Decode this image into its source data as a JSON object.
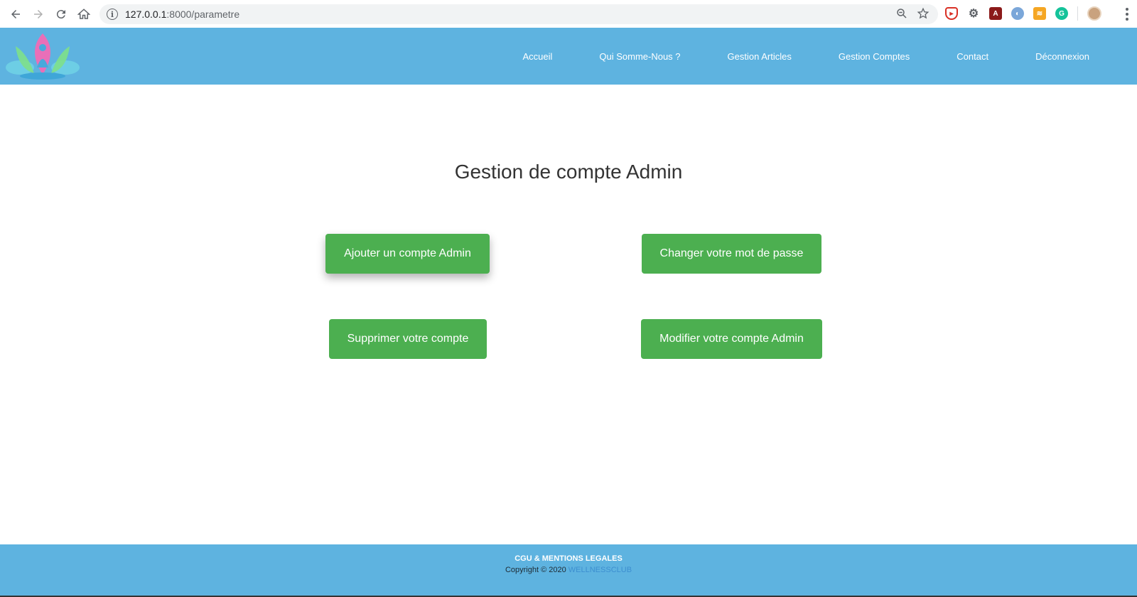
{
  "browser": {
    "url_host": "127.0.0.1",
    "url_path": ":8000/parametre"
  },
  "nav": {
    "items": [
      {
        "label": "Accueil"
      },
      {
        "label": "Qui Somme-Nous ?"
      },
      {
        "label": "Gestion Articles"
      },
      {
        "label": "Gestion Comptes"
      },
      {
        "label": "Contact"
      },
      {
        "label": "Déconnexion"
      }
    ]
  },
  "main": {
    "title": "Gestion de compte Admin",
    "buttons": {
      "add_admin": "Ajouter un compte Admin",
      "change_password": "Changer votre mot de passe",
      "delete_account": "Supprimer votre compte",
      "edit_admin": "Modifier votre compte Admin"
    }
  },
  "footer": {
    "title": "CGU & MENTIONS LEGALES",
    "copyright": "Copyright © 2020 ",
    "brand": "WELLNESSCLUB"
  },
  "colors": {
    "header": "#5eb3e0",
    "button": "#4caf50",
    "brand_link": "#3d8fd0"
  }
}
